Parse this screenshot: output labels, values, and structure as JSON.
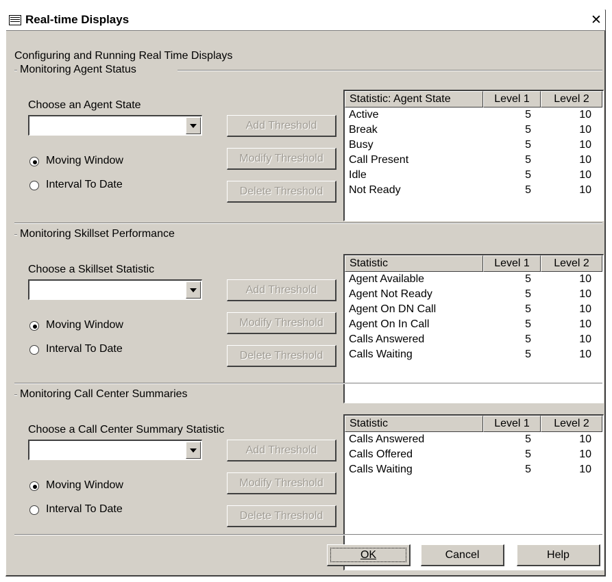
{
  "window": {
    "title": "Real-time Displays",
    "close_label": "✕",
    "heading": "Configuring and Running Real Time Displays"
  },
  "sections": [
    {
      "group_label": "Monitoring Agent Status",
      "choose_label": "Choose an Agent State",
      "combo_value": "",
      "radios": [
        {
          "label": "Moving Window",
          "checked": true
        },
        {
          "label": "Interval To Date",
          "checked": false
        }
      ],
      "buttons": [
        "Add Threshold",
        "Modify Threshold",
        "Delete Threshold"
      ],
      "columns": [
        "Statistic: Agent State",
        "Level 1",
        "Level 2"
      ],
      "rows": [
        {
          "name": "Active",
          "l1": "5",
          "l2": "10"
        },
        {
          "name": "Break",
          "l1": "5",
          "l2": "10"
        },
        {
          "name": "Busy",
          "l1": "5",
          "l2": "10"
        },
        {
          "name": "Call Present",
          "l1": "5",
          "l2": "10"
        },
        {
          "name": "Idle",
          "l1": "5",
          "l2": "10"
        },
        {
          "name": "Not Ready",
          "l1": "5",
          "l2": "10"
        }
      ]
    },
    {
      "group_label": "Monitoring Skillset Performance",
      "choose_label": "Choose a Skillset Statistic",
      "combo_value": "",
      "radios": [
        {
          "label": "Moving Window",
          "checked": true
        },
        {
          "label": "Interval To Date",
          "checked": false
        }
      ],
      "buttons": [
        "Add Threshold",
        "Modify Threshold",
        "Delete Threshold"
      ],
      "columns": [
        "Statistic",
        "Level 1",
        "Level 2"
      ],
      "rows": [
        {
          "name": "Agent Available",
          "l1": "5",
          "l2": "10"
        },
        {
          "name": "Agent Not Ready",
          "l1": "5",
          "l2": "10"
        },
        {
          "name": "Agent On DN Call",
          "l1": "5",
          "l2": "10"
        },
        {
          "name": "Agent On In Call",
          "l1": "5",
          "l2": "10"
        },
        {
          "name": "Calls Answered",
          "l1": "5",
          "l2": "10"
        },
        {
          "name": "Calls Waiting",
          "l1": "5",
          "l2": "10"
        }
      ]
    },
    {
      "group_label": "Monitoring Call Center Summaries",
      "choose_label": "Choose a Call Center Summary Statistic",
      "combo_value": "",
      "radios": [
        {
          "label": "Moving Window",
          "checked": true
        },
        {
          "label": "Interval To Date",
          "checked": false
        }
      ],
      "buttons": [
        "Add Threshold",
        "Modify Threshold",
        "Delete Threshold"
      ],
      "columns": [
        "Statistic",
        "Level 1",
        "Level 2"
      ],
      "rows": [
        {
          "name": "Calls Answered",
          "l1": "5",
          "l2": "10"
        },
        {
          "name": "Calls Offered",
          "l1": "5",
          "l2": "10"
        },
        {
          "name": "Calls Waiting",
          "l1": "5",
          "l2": "10"
        }
      ]
    }
  ],
  "footer": {
    "ok_label": "OK",
    "cancel_label": "Cancel",
    "help_label": "Help"
  }
}
